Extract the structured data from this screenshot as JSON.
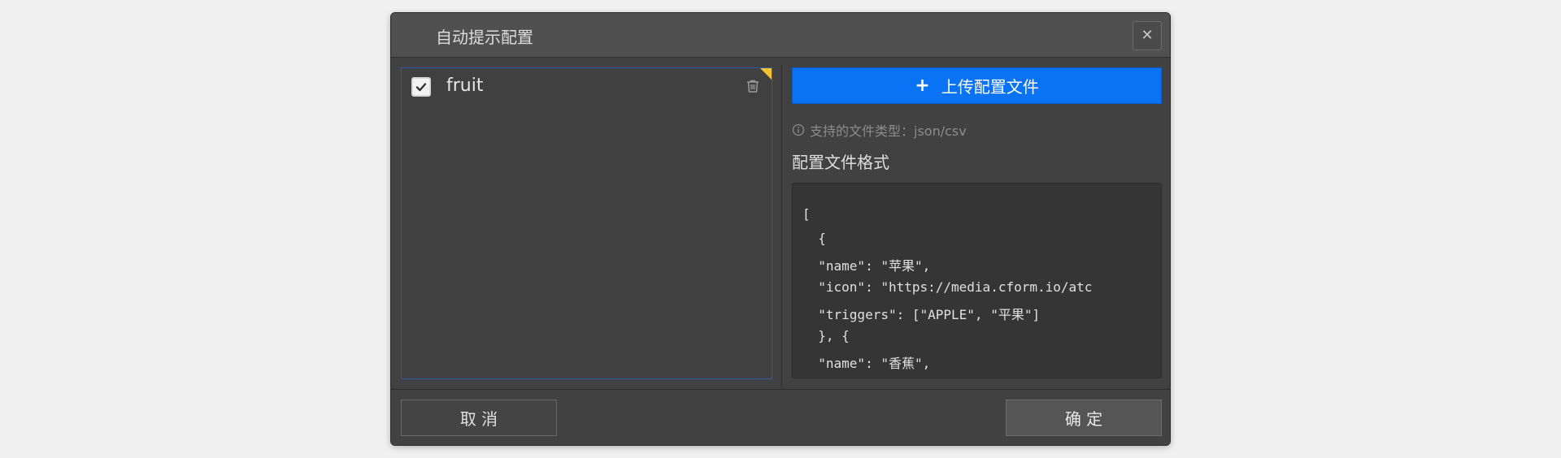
{
  "dialog": {
    "title": "自动提示配置",
    "close_icon": "close-icon"
  },
  "list": {
    "items": [
      {
        "label": "fruit",
        "checked": true,
        "icon": "trash-icon"
      }
    ],
    "corner_color": "#f2c230"
  },
  "upload": {
    "label": "上传配置文件",
    "plus": "+",
    "color": "#0a73f5"
  },
  "hint": {
    "text": "支持的文件类型：json/csv",
    "icon": "info-icon"
  },
  "format": {
    "title": "配置文件格式",
    "code_lines": [
      "[",
      "  {",
      "  \"name\": \"苹果\",",
      "  \"icon\": \"https://media.cform.io/atc",
      "  \"triggers\": [\"APPLE\", \"平果\"]",
      "  }, {",
      "  \"name\": \"香蕉\","
    ]
  },
  "footer": {
    "cancel_label": "取 消",
    "ok_label": "确 定"
  }
}
